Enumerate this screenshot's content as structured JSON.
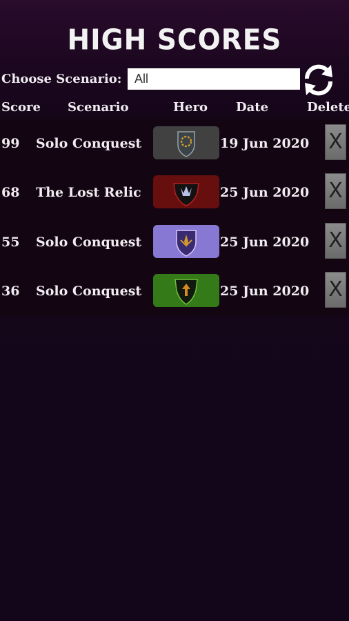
{
  "title": "HIGH SCORES",
  "filter": {
    "label": "Choose Scenario:",
    "value": "All"
  },
  "columns": {
    "score": "Score",
    "scenario": "Scenario",
    "hero": "Hero",
    "date": "Date",
    "delete": "Delete"
  },
  "rows": [
    {
      "score": "99",
      "scenario": "Solo Conquest",
      "date": "19 Jun 2020",
      "hero_color": "#5a5a5a",
      "hero_icon": "gray-shield-icon",
      "delete_label": "X"
    },
    {
      "score": "68",
      "scenario": "The Lost Relic",
      "date": "25 Jun 2020",
      "hero_color": "#8a1a1a",
      "hero_icon": "red-shield-icon",
      "delete_label": "X"
    },
    {
      "score": "55",
      "scenario": "Solo Conquest",
      "date": "25 Jun 2020",
      "hero_color": "#7b68c8",
      "hero_icon": "purple-shield-icon",
      "delete_label": "X"
    },
    {
      "score": "36",
      "scenario": "Solo Conquest",
      "date": "25 Jun 2020",
      "hero_color": "#3d8a1c",
      "hero_icon": "green-shield-icon",
      "delete_label": "X"
    }
  ]
}
